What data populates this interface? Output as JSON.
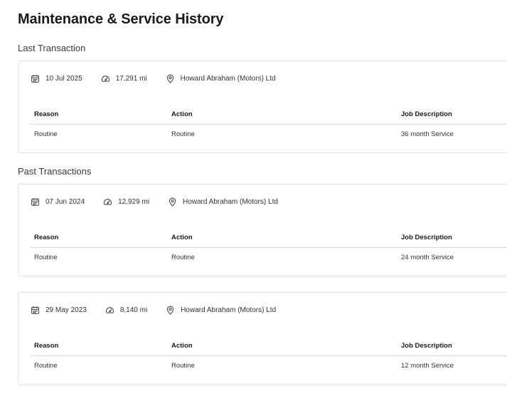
{
  "page": {
    "title": "Maintenance & Service History"
  },
  "sections": {
    "last_heading": "Last Transaction",
    "past_heading": "Past Transactions"
  },
  "table_headers": {
    "reason": "Reason",
    "action": "Action",
    "job_description": "Job Description"
  },
  "icons": {
    "date": "calendar-icon",
    "mileage": "speedometer-icon",
    "location": "location-pin-icon"
  },
  "transactions": [
    {
      "date": "10 Jul 2025",
      "mileage": "17,291 mi",
      "garage": "Howard Abraham (Motors) Ltd",
      "reason": "Routine",
      "action": "Routine",
      "job_description": "36 month Service"
    },
    {
      "date": "07 Jun 2024",
      "mileage": "12,929 mi",
      "garage": "Howard Abraham (Motors) Ltd",
      "reason": "Routine",
      "action": "Routine",
      "job_description": "24 month Service"
    },
    {
      "date": "29 May 2023",
      "mileage": "8,140 mi",
      "garage": "Howard Abraham (Motors) Ltd",
      "reason": "Routine",
      "action": "Routine",
      "job_description": "12 month Service"
    }
  ]
}
